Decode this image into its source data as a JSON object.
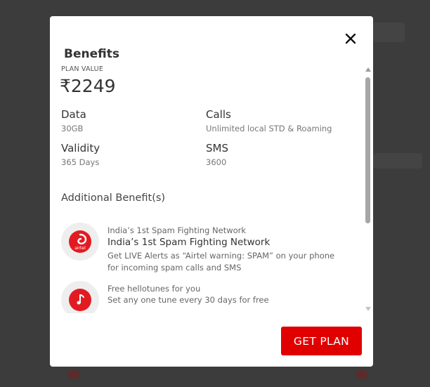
{
  "modal": {
    "title": "Benefits",
    "close_icon": "close-icon",
    "plan_value_label": "PLAN VALUE",
    "plan_price": "₹2249",
    "stats": [
      {
        "label": "Data",
        "value": "30GB"
      },
      {
        "label": "Calls",
        "value": "Unlimited local STD & Roaming"
      },
      {
        "label": "Validity",
        "value": "365 Days"
      },
      {
        "label": "SMS",
        "value": "3600"
      }
    ],
    "additional_title": "Additional Benefit(s)",
    "benefits": [
      {
        "icon": "airtel-logo-icon",
        "subtitle": "India’s 1st Spam Fighting Network",
        "title": "India’s 1st Spam Fighting Network",
        "description": "Get LIVE Alerts as “Airtel warning: SPAM” on your phone for incoming spam calls and SMS"
      },
      {
        "icon": "hellotunes-icon",
        "subtitle": "Free hellotunes for you",
        "description": "Set any one tune every 30 days for free"
      }
    ],
    "cta_label": "GET PLAN"
  },
  "colors": {
    "overlay": "#3c3c3c",
    "accent": "#e00000",
    "airtel_red": "#e21b23"
  }
}
